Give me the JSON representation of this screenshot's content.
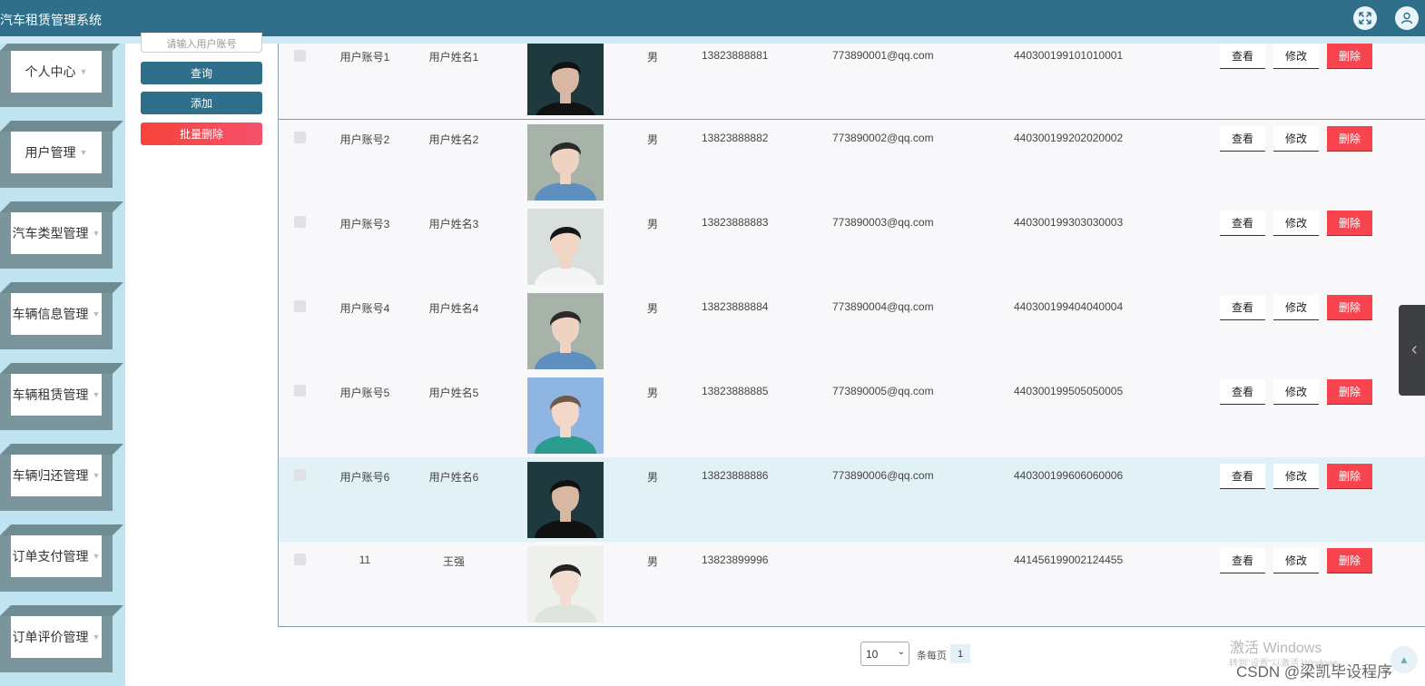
{
  "app": {
    "title": "汽车租赁管理系统"
  },
  "header": {
    "fullscreen_icon": "expand-icon",
    "user_icon": "user-icon"
  },
  "sidebar": {
    "items": [
      {
        "label": "个人中心"
      },
      {
        "label": "用户管理"
      },
      {
        "label": "汽车类型管理"
      },
      {
        "label": "车辆信息管理"
      },
      {
        "label": "车辆租赁管理"
      },
      {
        "label": "车辆归还管理"
      },
      {
        "label": "订单支付管理"
      },
      {
        "label": "订单评价管理"
      }
    ]
  },
  "search": {
    "placeholder": "请输入用户账号"
  },
  "actions": {
    "query": "查询",
    "add": "添加",
    "batch_delete": "批量删除"
  },
  "table": {
    "rows": [
      {
        "account": "用户账号1",
        "name": "用户姓名1",
        "sex": "男",
        "phone": "13823888881",
        "email": "773890001@qq.com",
        "id_no": "440300199101010001"
      },
      {
        "account": "用户账号2",
        "name": "用户姓名2",
        "sex": "男",
        "phone": "13823888882",
        "email": "773890002@qq.com",
        "id_no": "440300199202020002"
      },
      {
        "account": "用户账号3",
        "name": "用户姓名3",
        "sex": "男",
        "phone": "13823888883",
        "email": "773890003@qq.com",
        "id_no": "440300199303030003"
      },
      {
        "account": "用户账号4",
        "name": "用户姓名4",
        "sex": "男",
        "phone": "13823888884",
        "email": "773890004@qq.com",
        "id_no": "440300199404040004"
      },
      {
        "account": "用户账号5",
        "name": "用户姓名5",
        "sex": "男",
        "phone": "13823888885",
        "email": "773890005@qq.com",
        "id_no": "440300199505050005"
      },
      {
        "account": "用户账号6",
        "name": "用户姓名6",
        "sex": "男",
        "phone": "13823888886",
        "email": "773890006@qq.com",
        "id_no": "440300199606060006"
      },
      {
        "account": "11",
        "name": "王强",
        "sex": "男",
        "phone": "13823899996",
        "email": "",
        "id_no": "441456199002124455"
      }
    ],
    "row_actions": {
      "view": "查看",
      "edit": "修改",
      "delete": "删除"
    }
  },
  "pagination": {
    "page_size": "10",
    "page_size_label": "条每页",
    "current_page": "1"
  },
  "overlay": {
    "windows_activation": "激活 Windows",
    "windows_activation_sub": "转到\"设置\"以激活 Windows。",
    "csdn": "CSDN @梁凯毕设程序"
  },
  "colors": {
    "header": "#2f6f8a",
    "sidebar": "#bfe3ef",
    "danger": "#f7444e"
  }
}
